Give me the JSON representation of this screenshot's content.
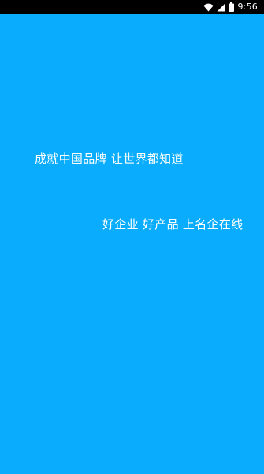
{
  "status_bar": {
    "time": "9:56",
    "icons": [
      "wifi-icon",
      "signal-icon",
      "battery-icon"
    ]
  },
  "splash": {
    "background_color": "#0aadfd",
    "slogan_line_1": "成就中国品牌  让世界都知道",
    "slogan_line_2": "好企业  好产品  上名企在线"
  }
}
